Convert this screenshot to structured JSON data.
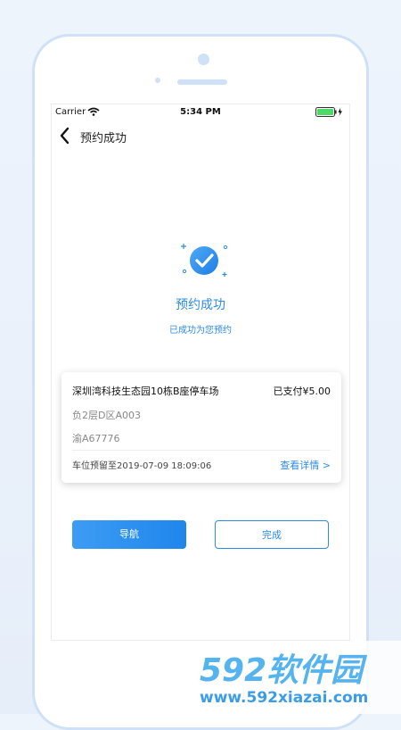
{
  "status_bar": {
    "carrier": "Carrier",
    "time": "5:34 PM"
  },
  "nav": {
    "title": "预约成功",
    "back_icon": "chevron-left-icon"
  },
  "result": {
    "icon": "checkmark-circle-icon",
    "title": "预约成功",
    "subtitle": "已成功为您预约"
  },
  "booking": {
    "lot_name": "深圳湾科技生态园10栋B座停车场",
    "payment_status": "已支付¥5.00",
    "space": "负2层D区A003",
    "plate": "渝A67776",
    "reserve_until": "车位预留至2019-07-09 18:09:06",
    "details_link": "查看详情 >"
  },
  "actions": {
    "navigate": "导航",
    "done": "完成"
  },
  "watermark": {
    "logo": "592软件园",
    "url": "www.592xiazai.com"
  },
  "colors": {
    "accent": "#2d8be8",
    "frame": "#cfe1f8",
    "battery": "#4cd964"
  }
}
